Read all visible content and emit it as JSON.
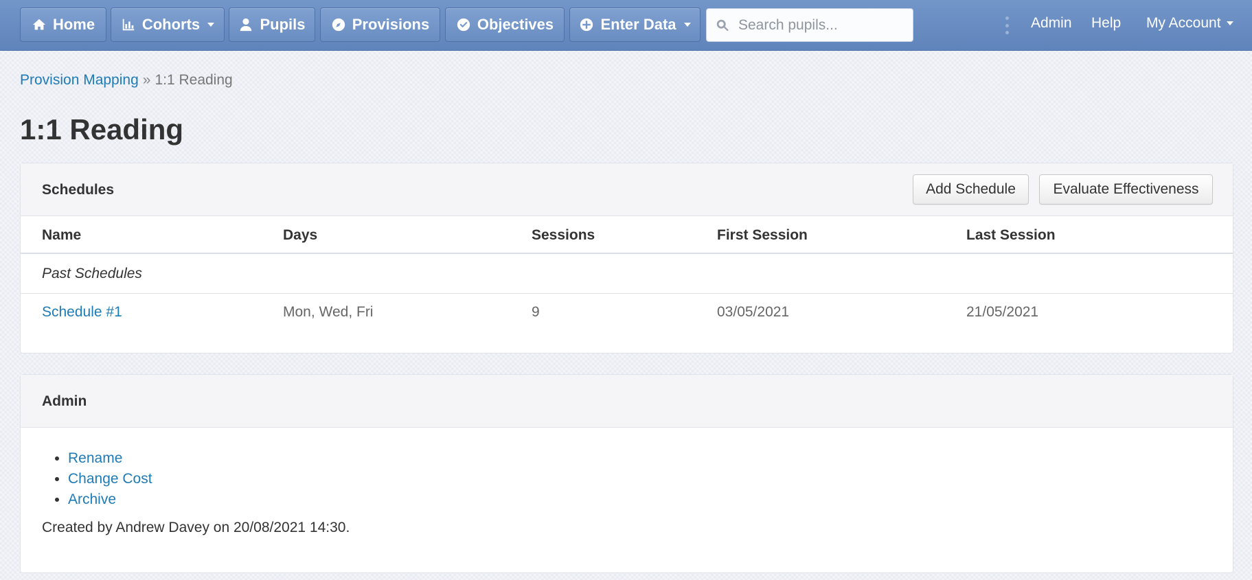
{
  "nav": {
    "home": "Home",
    "cohorts": "Cohorts",
    "pupils": "Pupils",
    "provisions": "Provisions",
    "objectives": "Objectives",
    "enter_data": "Enter Data",
    "search_placeholder": "Search pupils...",
    "admin": "Admin",
    "help": "Help",
    "my_account": "My Account"
  },
  "breadcrumb": {
    "parent": "Provision Mapping",
    "separator": "»",
    "current": "1:1 Reading"
  },
  "page_title": "1:1 Reading",
  "schedules": {
    "heading": "Schedules",
    "add_button": "Add Schedule",
    "evaluate_button": "Evaluate Effectiveness",
    "columns": [
      "Name",
      "Days",
      "Sessions",
      "First Session",
      "Last Session"
    ],
    "group_label": "Past Schedules",
    "rows": [
      {
        "name": "Schedule #1",
        "days": "Mon, Wed, Fri",
        "sessions": "9",
        "first": "03/05/2021",
        "last": "21/05/2021"
      }
    ]
  },
  "admin_panel": {
    "heading": "Admin",
    "links": [
      "Rename",
      "Change Cost",
      "Archive"
    ],
    "created": "Created by Andrew Davey on 20/08/2021 14:30."
  }
}
